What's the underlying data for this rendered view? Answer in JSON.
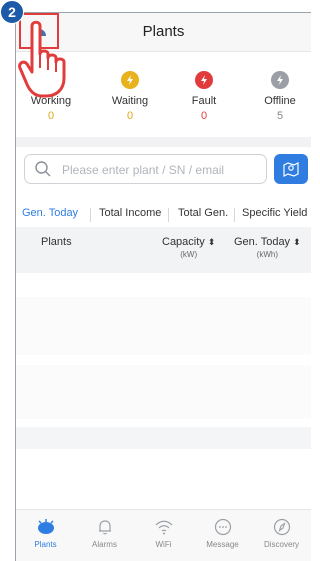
{
  "step_number": "2",
  "header": {
    "title": "Plants"
  },
  "statuses": [
    {
      "label": "Working",
      "count": "0",
      "color": "#52b936",
      "count_color": "#e0a51a",
      "icon": "bolt-icon"
    },
    {
      "label": "Waiting",
      "count": "0",
      "color": "#e7b21b",
      "count_color": "#e0a51a",
      "icon": "bolt-icon"
    },
    {
      "label": "Fault",
      "count": "0",
      "color": "#e23b3b",
      "count_color": "#e23b3b",
      "icon": "bolt-icon"
    },
    {
      "label": "Offline",
      "count": "5",
      "color": "#9b9fa5",
      "count_color": "#888888",
      "icon": "bolt-icon"
    }
  ],
  "search": {
    "placeholder": "Please enter plant / SN / email",
    "value": ""
  },
  "tabs": [
    "Gen. Today",
    "Total Income",
    "Total Gen.",
    "Specific Yield"
  ],
  "table": {
    "col_plants": "Plants",
    "col_capacity": "Capacity",
    "col_capacity_unit": "(kW)",
    "col_gen_today": "Gen. Today",
    "col_gen_today_unit": "(kWh)",
    "sort_glyph": "⬍"
  },
  "bottom_nav": [
    {
      "label": "Plants",
      "icon": "solar-panel-icon"
    },
    {
      "label": "Alarms",
      "icon": "bell-icon"
    },
    {
      "label": "WiFi",
      "icon": "wifi-icon"
    },
    {
      "label": "Message",
      "icon": "chat-bubble-icon"
    },
    {
      "label": "Discovery",
      "icon": "compass-icon"
    }
  ],
  "colors": {
    "accent": "#2f7de1",
    "highlight": "#e23b3b",
    "badge": "#1d5aa8"
  }
}
